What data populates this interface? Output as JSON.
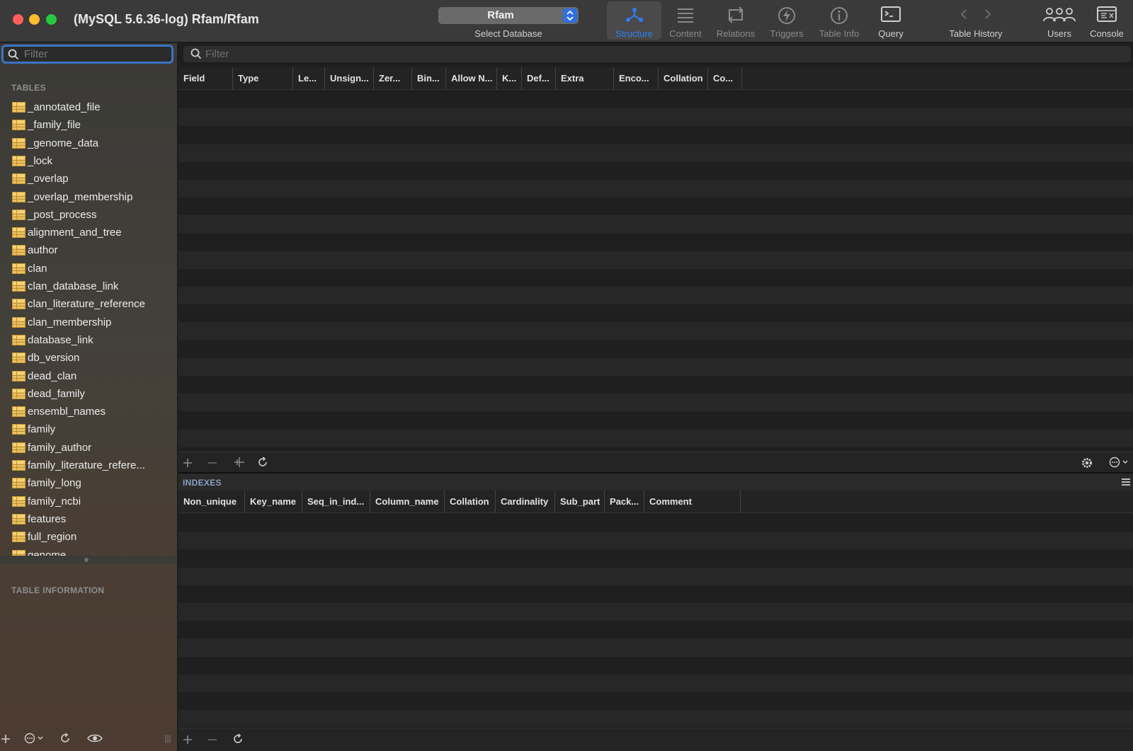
{
  "window": {
    "title": "(MySQL 5.6.36-log) Rfam/Rfam"
  },
  "toolbar": {
    "database_select": {
      "value": "Rfam",
      "caption": "Select Database"
    },
    "tools": [
      {
        "id": "structure",
        "label": "Structure",
        "icon": "structure-icon",
        "state": "active"
      },
      {
        "id": "content",
        "label": "Content",
        "icon": "content-icon",
        "state": "disabled"
      },
      {
        "id": "relations",
        "label": "Relations",
        "icon": "relations-icon",
        "state": "disabled"
      },
      {
        "id": "triggers",
        "label": "Triggers",
        "icon": "triggers-icon",
        "state": "disabled"
      },
      {
        "id": "table_info",
        "label": "Table Info",
        "icon": "info-icon",
        "state": "disabled"
      },
      {
        "id": "query",
        "label": "Query",
        "icon": "query-icon",
        "state": "enabled"
      },
      {
        "id": "table_history",
        "label": "Table History",
        "icon": "history-arrows-icon",
        "state": "enabled"
      },
      {
        "id": "users",
        "label": "Users",
        "icon": "users-icon",
        "state": "enabled"
      },
      {
        "id": "console",
        "label": "Console",
        "icon": "console-icon",
        "state": "enabled"
      }
    ]
  },
  "sidebar": {
    "filter_placeholder": "Filter",
    "tables_header": "TABLES",
    "tables": [
      "_annotated_file",
      "_family_file",
      "_genome_data",
      "_lock",
      "_overlap",
      "_overlap_membership",
      "_post_process",
      "alignment_and_tree",
      "author",
      "clan",
      "clan_database_link",
      "clan_literature_reference",
      "clan_membership",
      "database_link",
      "db_version",
      "dead_clan",
      "dead_family",
      "ensembl_names",
      "family",
      "family_author",
      "family_literature_refere...",
      "family_long",
      "family_ncbi",
      "features",
      "full_region",
      "genome"
    ],
    "table_info_header": "TABLE INFORMATION"
  },
  "structure": {
    "filter_placeholder": "Filter",
    "columns": [
      "Field",
      "Type",
      "Le...",
      "Unsign...",
      "Zer...",
      "Bin...",
      "Allow N...",
      "K...",
      "Def...",
      "Extra",
      "Enco...",
      "Collation",
      "Co..."
    ]
  },
  "indexes": {
    "header": "INDEXES",
    "columns": [
      "Non_unique",
      "Key_name",
      "Seq_in_ind...",
      "Column_name",
      "Collation",
      "Cardinality",
      "Sub_part",
      "Pack...",
      "Comment"
    ]
  },
  "colors": {
    "accent": "#2f7cf6",
    "table_icon": "#e9c067"
  }
}
